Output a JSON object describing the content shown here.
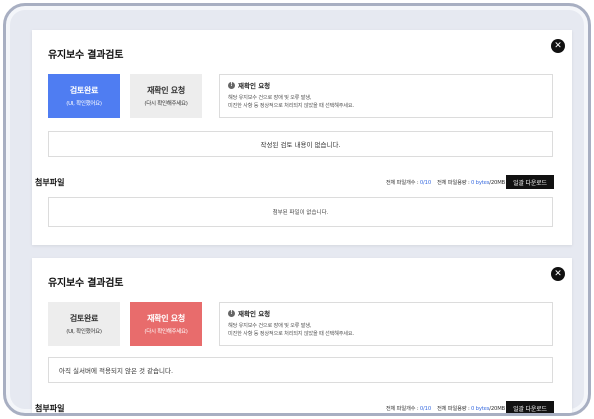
{
  "panels": [
    {
      "title": "유지보수 결과검토",
      "complete_label": "검토완료",
      "complete_sub": "(UI, 확인했어요)",
      "recheck_label": "재확인 요청",
      "recheck_sub": "(다시 확인해주세요)",
      "request_heading": "재확인 요청",
      "request_desc_1": "해당 유지보수 건으로 장애 및 오류 발생,",
      "request_desc_2": "미진한 사항 등 정상적으로 처리되지 않았을 때 선택해주세요.",
      "message": "작성된 검토 내용이 없습니다.",
      "attach_title": "첨부파일",
      "file_count_label": "전체 파일개수 : ",
      "file_count_value": "0/10",
      "file_size_label": "전체 파일용량 : ",
      "file_size_value": "0 bytes",
      "file_size_total": "/20MB",
      "download_label": "일괄 다운로드",
      "no_files": "첨부된 파일이 없습니다.",
      "active": "complete",
      "active_color": "#4f7df2"
    },
    {
      "title": "유지보수 결과검토",
      "complete_label": "검토완료",
      "complete_sub": "(UI, 확인했어요)",
      "recheck_label": "재확인 요청",
      "recheck_sub": "(다시 확인해주세요)",
      "request_heading": "재확인 요청",
      "request_desc_1": "해당 유지보수 건으로 장애 및 오류 발생,",
      "request_desc_2": "미진한 사항 등 정상적으로 처리되지 않았을 때 선택해주세요.",
      "message": "아직 실서버에 적용되지 않은 것 같습니다.",
      "attach_title": "첨부파일",
      "file_count_label": "전체 파일개수 : ",
      "file_count_value": "0/10",
      "file_size_label": "전체 파일용량 : ",
      "file_size_value": "0 bytes",
      "file_size_total": "/20MB",
      "download_label": "일괄 다운로드",
      "active": "recheck",
      "active_color": "#e86c6c"
    }
  ],
  "icons": {
    "close": "close-icon",
    "info": "info-icon"
  }
}
